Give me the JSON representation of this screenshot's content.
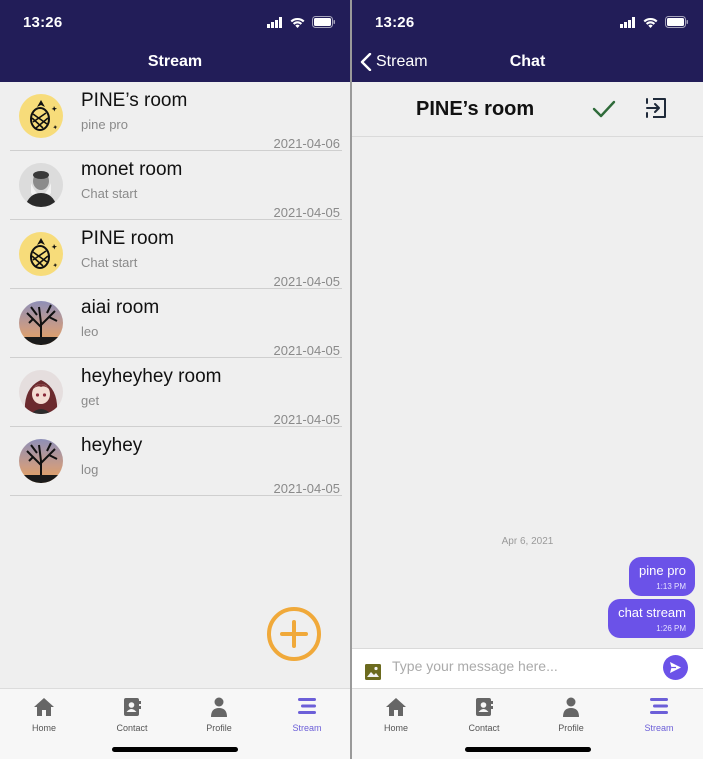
{
  "status": {
    "time": "13:26"
  },
  "left": {
    "title": "Stream",
    "rooms": [
      {
        "name": "PINE’s room",
        "last": "pine pro",
        "date": "2021-04-06",
        "avatar": "pineapple-icon"
      },
      {
        "name": "monet room",
        "last": "Chat start",
        "date": "2021-04-05",
        "avatar": "portrait-photo"
      },
      {
        "name": "PINE room",
        "last": "Chat start",
        "date": "2021-04-05",
        "avatar": "pineapple-icon"
      },
      {
        "name": "aiai room",
        "last": "leo",
        "date": "2021-04-05",
        "avatar": "tree-sunset-photo"
      },
      {
        "name": "heyheyhey room",
        "last": "get",
        "date": "2021-04-05",
        "avatar": "anime-girl-photo"
      },
      {
        "name": "heyhey",
        "last": "log",
        "date": "2021-04-05",
        "avatar": "tree-sunset-photo"
      }
    ]
  },
  "right": {
    "back_label": "Stream",
    "title": "Chat",
    "room_title": "PINE’s room",
    "date_separator": "Apr 6, 2021",
    "messages": [
      {
        "text": "pine pro",
        "time": "1:13 PM"
      },
      {
        "text": "chat stream",
        "time": "1:26 PM"
      }
    ],
    "input_placeholder": "Type your message here..."
  },
  "tabs": [
    {
      "label": "Home",
      "icon": "home-icon"
    },
    {
      "label": "Contact",
      "icon": "contact-book-icon"
    },
    {
      "label": "Profile",
      "icon": "person-icon"
    },
    {
      "label": "Stream",
      "icon": "stream-lines-icon"
    }
  ],
  "active_tab": "Stream",
  "colors": {
    "navbar": "#221d58",
    "accent": "#6b52e8",
    "fab": "#f0a93a",
    "check": "#2f6b3a",
    "active_tab": "#6c5fd8"
  }
}
